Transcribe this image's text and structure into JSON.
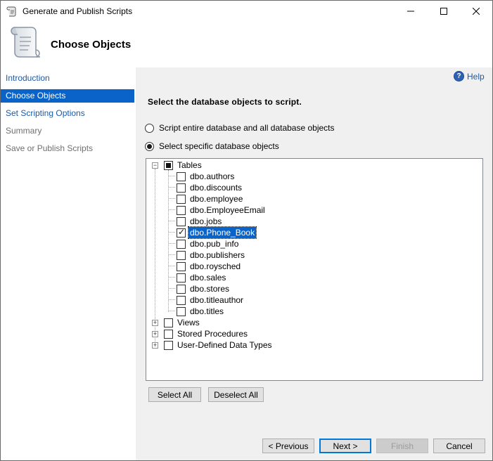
{
  "window": {
    "title": "Generate and Publish Scripts",
    "controls": {
      "minimize": "minimize-icon",
      "maximize": "maximize-icon",
      "close": "close-icon"
    }
  },
  "header": {
    "title": "Choose Objects",
    "icon": "scroll-icon"
  },
  "nav": {
    "items": [
      {
        "label": "Introduction",
        "state": "link"
      },
      {
        "label": "Choose Objects",
        "state": "active"
      },
      {
        "label": "Set Scripting Options",
        "state": "link"
      },
      {
        "label": "Summary",
        "state": "disabled"
      },
      {
        "label": "Save or Publish Scripts",
        "state": "disabled"
      }
    ]
  },
  "content": {
    "help_label": "Help",
    "instruction": "Select the database objects to script.",
    "options": [
      {
        "label": "Script entire database and all database objects",
        "selected": false
      },
      {
        "label": "Select specific database objects",
        "selected": true
      }
    ],
    "tree": {
      "tables": {
        "label": "Tables",
        "state": "partial",
        "expanded": true,
        "children": [
          {
            "label": "dbo.authors",
            "checked": false
          },
          {
            "label": "dbo.discounts",
            "checked": false
          },
          {
            "label": "dbo.employee",
            "checked": false
          },
          {
            "label": "dbo.EmployeeEmail",
            "checked": false
          },
          {
            "label": "dbo.jobs",
            "checked": false
          },
          {
            "label": "dbo.Phone_Book",
            "checked": true,
            "selected": true
          },
          {
            "label": "dbo.pub_info",
            "checked": false
          },
          {
            "label": "dbo.publishers",
            "checked": false
          },
          {
            "label": "dbo.roysched",
            "checked": false
          },
          {
            "label": "dbo.sales",
            "checked": false
          },
          {
            "label": "dbo.stores",
            "checked": false
          },
          {
            "label": "dbo.titleauthor",
            "checked": false
          },
          {
            "label": "dbo.titles",
            "checked": false
          }
        ]
      },
      "other": [
        {
          "label": "Views",
          "checked": false,
          "expanded": false
        },
        {
          "label": "Stored Procedures",
          "checked": false,
          "expanded": false
        },
        {
          "label": "User-Defined Data Types",
          "checked": false,
          "expanded": false
        }
      ]
    },
    "select_all_label": "Select All",
    "deselect_all_label": "Deselect All"
  },
  "footer": {
    "previous_label": "< Previous",
    "next_label": "Next >",
    "finish_label": "Finish",
    "cancel_label": "Cancel"
  },
  "colors": {
    "accent": "#0a63c9",
    "link": "#1c5aa6",
    "panel": "#f0f0f0"
  }
}
